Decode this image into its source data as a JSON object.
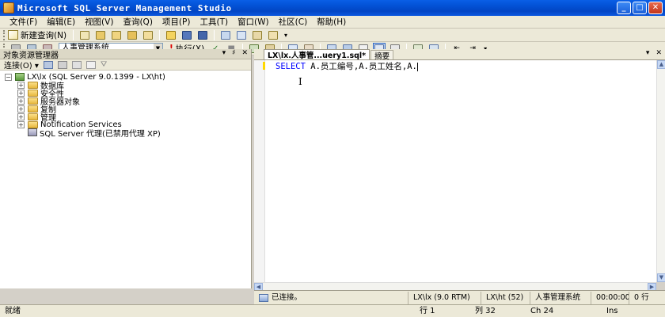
{
  "window": {
    "title": "Microsoft SQL Server Management Studio"
  },
  "menu": [
    "文件(F)",
    "编辑(E)",
    "视图(V)",
    "查询(Q)",
    "项目(P)",
    "工具(T)",
    "窗口(W)",
    "社区(C)",
    "帮助(H)"
  ],
  "toolbar": {
    "new_query_label": "新建查询(N)",
    "database_selected": "人事管理系统",
    "execute_label": "执行(X)"
  },
  "object_explorer": {
    "title": "对象资源管理器",
    "connect_label": "连接(O)",
    "server_node": "LX\\lx (SQL Server 9.0.1399 - LX\\ht)",
    "children": [
      "数据库",
      "安全性",
      "服务器对象",
      "复制",
      "管理",
      "Notification Services"
    ],
    "agent_node": "SQL Server 代理(已禁用代理 XP)"
  },
  "editor": {
    "active_tab": "LX\\lx.人事管...uery1.sql*",
    "summary_tab": "摘要",
    "code_keyword": "SELECT",
    "code_rest": " A.员工编号,A.员工姓名,A."
  },
  "query_status": {
    "connection_status": "已连接。",
    "server": "LX\\lx (9.0 RTM)",
    "user": "LX\\ht (52)",
    "database": "人事管理系统",
    "elapsed": "00:00:00",
    "rows": "0 行"
  },
  "status_bar": {
    "ready": "就绪",
    "line": "行 1",
    "column": "列 32",
    "char": "Ch 24",
    "mode": "Ins"
  }
}
